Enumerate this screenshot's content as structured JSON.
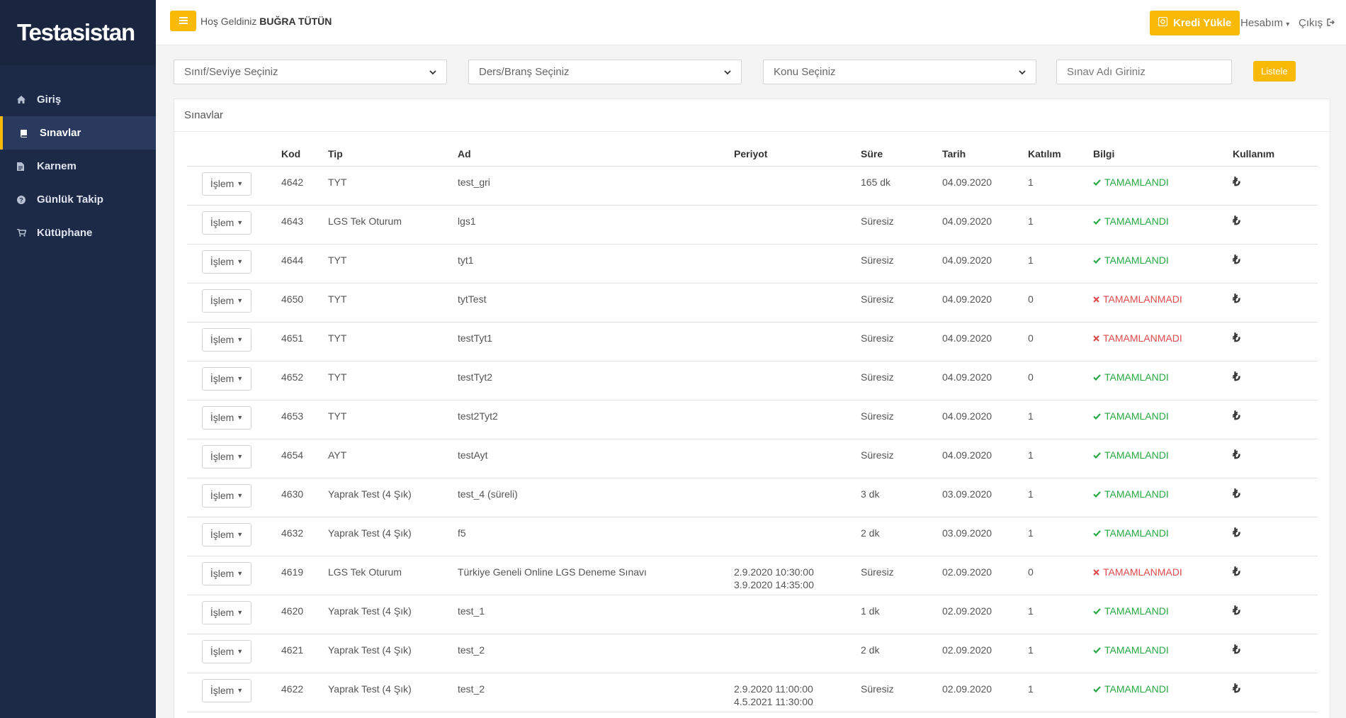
{
  "brand": "Testasistan",
  "nav": [
    {
      "label": "Giriş",
      "icon": "home-icon",
      "active": false
    },
    {
      "label": "Sınavlar",
      "icon": "book-icon",
      "active": true
    },
    {
      "label": "Karnem",
      "icon": "file-icon",
      "active": false
    },
    {
      "label": "Günlük Takip",
      "icon": "question-circle-icon",
      "active": false
    },
    {
      "label": "Kütüphane",
      "icon": "cart-icon",
      "active": false
    }
  ],
  "topbar": {
    "welcome_prefix": "Hoş Geldiniz",
    "user_name": "BUĞRA TÜTÜN",
    "credit_button": "Kredi Yükle",
    "account": "Hesabım",
    "logout": "Çıkış"
  },
  "filters": {
    "level_select": "Sınıf/Seviye Seçiniz",
    "subject_select": "Ders/Branş Seçiniz",
    "topic_select": "Konu Seçiniz",
    "exam_name_placeholder": "Sınav Adı Giriniz",
    "list_button": "Listele"
  },
  "panel": {
    "title": "Sınavlar",
    "action_label": "İşlem",
    "columns": [
      "",
      "Kod",
      "Tip",
      "Ad",
      "Periyot",
      "Süre",
      "Tarih",
      "Katılım",
      "Bilgi",
      "Kullanım"
    ],
    "rows": [
      {
        "kod": "4642",
        "tip": "TYT",
        "ad": "test_gri",
        "periyot": [
          "",
          ""
        ],
        "sure": "165 dk",
        "tarih": "04.09.2020",
        "katilim": "1",
        "bilgi": "TAMAMLANDI",
        "ok": true
      },
      {
        "kod": "4643",
        "tip": "LGS Tek Oturum",
        "ad": "lgs1",
        "periyot": [
          "",
          ""
        ],
        "sure": "Süresiz",
        "tarih": "04.09.2020",
        "katilim": "1",
        "bilgi": "TAMAMLANDI",
        "ok": true
      },
      {
        "kod": "4644",
        "tip": "TYT",
        "ad": "tyt1",
        "periyot": [
          "",
          ""
        ],
        "sure": "Süresiz",
        "tarih": "04.09.2020",
        "katilim": "1",
        "bilgi": "TAMAMLANDI",
        "ok": true
      },
      {
        "kod": "4650",
        "tip": "TYT",
        "ad": "tytTest",
        "periyot": [
          "",
          ""
        ],
        "sure": "Süresiz",
        "tarih": "04.09.2020",
        "katilim": "0",
        "bilgi": "TAMAMLANMADI",
        "ok": false
      },
      {
        "kod": "4651",
        "tip": "TYT",
        "ad": "testTyt1",
        "periyot": [
          "",
          ""
        ],
        "sure": "Süresiz",
        "tarih": "04.09.2020",
        "katilim": "0",
        "bilgi": "TAMAMLANMADI",
        "ok": false
      },
      {
        "kod": "4652",
        "tip": "TYT",
        "ad": "testTyt2",
        "periyot": [
          "",
          ""
        ],
        "sure": "Süresiz",
        "tarih": "04.09.2020",
        "katilim": "0",
        "bilgi": "TAMAMLANDI",
        "ok": true
      },
      {
        "kod": "4653",
        "tip": "TYT",
        "ad": "test2Tyt2",
        "periyot": [
          "",
          ""
        ],
        "sure": "Süresiz",
        "tarih": "04.09.2020",
        "katilim": "1",
        "bilgi": "TAMAMLANDI",
        "ok": true
      },
      {
        "kod": "4654",
        "tip": "AYT",
        "ad": "testAyt",
        "periyot": [
          "",
          ""
        ],
        "sure": "Süresiz",
        "tarih": "04.09.2020",
        "katilim": "1",
        "bilgi": "TAMAMLANDI",
        "ok": true
      },
      {
        "kod": "4630",
        "tip": "Yaprak Test (4 Şık)",
        "ad": "test_4 (süreli)",
        "periyot": [
          "",
          ""
        ],
        "sure": "3 dk",
        "tarih": "03.09.2020",
        "katilim": "1",
        "bilgi": "TAMAMLANDI",
        "ok": true
      },
      {
        "kod": "4632",
        "tip": "Yaprak Test (4 Şık)",
        "ad": "f5",
        "periyot": [
          "",
          ""
        ],
        "sure": "2 dk",
        "tarih": "03.09.2020",
        "katilim": "1",
        "bilgi": "TAMAMLANDI",
        "ok": true
      },
      {
        "kod": "4619",
        "tip": "LGS Tek Oturum",
        "ad": "Türkiye Geneli Online LGS Deneme Sınavı",
        "periyot": [
          "2.9.2020 10:30:00",
          "3.9.2020 14:35:00"
        ],
        "sure": "Süresiz",
        "tarih": "02.09.2020",
        "katilim": "0",
        "bilgi": "TAMAMLANMADI",
        "ok": false
      },
      {
        "kod": "4620",
        "tip": "Yaprak Test (4 Şık)",
        "ad": "test_1",
        "periyot": [
          "",
          ""
        ],
        "sure": "1 dk",
        "tarih": "02.09.2020",
        "katilim": "1",
        "bilgi": "TAMAMLANDI",
        "ok": true
      },
      {
        "kod": "4621",
        "tip": "Yaprak Test (4 Şık)",
        "ad": "test_2",
        "periyot": [
          "",
          ""
        ],
        "sure": "2 dk",
        "tarih": "02.09.2020",
        "katilim": "1",
        "bilgi": "TAMAMLANDI",
        "ok": true
      },
      {
        "kod": "4622",
        "tip": "Yaprak Test (4 Şık)",
        "ad": "test_2",
        "periyot": [
          "2.9.2020 11:00:00",
          "4.5.2021 11:30:00"
        ],
        "sure": "Süresiz",
        "tarih": "02.09.2020",
        "katilim": "1",
        "bilgi": "TAMAMLANDI",
        "ok": true
      }
    ]
  },
  "colors": {
    "accent": "#f8ba07",
    "sidebar": "#1d2a47",
    "success": "#27a844",
    "danger": "#e04b4b"
  }
}
